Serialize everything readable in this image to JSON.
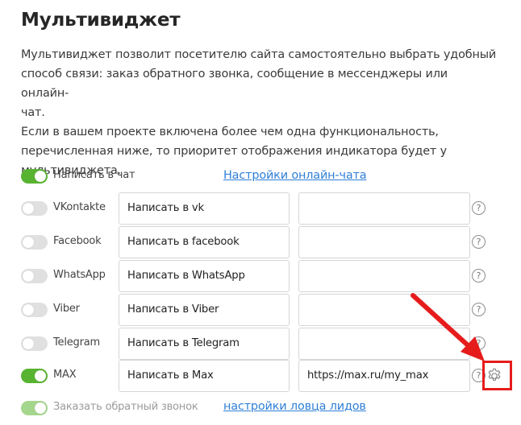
{
  "title": "Мультивиджет",
  "description": {
    "line1": "Мультивиджет позволит посетителю сайта самостоятельно выбрать удобный",
    "line2": "способ связи: заказ обратного звонка, сообщение в мессенджеры или онлайн-",
    "line3": "чат.",
    "line4": "Если в вашем проекте включена более чем одна функциональность,",
    "line5": "перечисленная ниже, то приоритет отображения индикатора будет у",
    "line6": "мультивиджета."
  },
  "chat": {
    "label": "Написать в чат",
    "enabled": true,
    "link": "Настройки онлайн-чата"
  },
  "channels": [
    {
      "name": "VKontakte",
      "enabled": false,
      "text": "Написать в vk",
      "url": "",
      "help": "?"
    },
    {
      "name": "Facebook",
      "enabled": false,
      "text": "Написать в facebook",
      "url": "",
      "help": "?"
    },
    {
      "name": "WhatsApp",
      "enabled": false,
      "text": "Написать в WhatsApp",
      "url": "",
      "help": "?"
    },
    {
      "name": "Viber",
      "enabled": false,
      "text": "Написать в Viber",
      "url": "",
      "help": "?"
    },
    {
      "name": "Telegram",
      "enabled": false,
      "text": "Написать в Telegram",
      "url": "",
      "help": "?"
    },
    {
      "name": "MAX",
      "enabled": true,
      "text": "Написать в Max",
      "url": "https://max.ru/my_max",
      "help": "?"
    }
  ],
  "callback": {
    "label": "Заказать обратный звонок",
    "enabled": true,
    "link": "настройки ловца лидов"
  },
  "icons": {
    "help": "question-circle-icon",
    "settings": "gear-icon",
    "annotation": "red-arrow"
  },
  "colors": {
    "toggle_on": "#58b331",
    "toggle_off": "#e0e0e0",
    "link": "#2f7fd6",
    "annotation": "#e61c1c"
  }
}
